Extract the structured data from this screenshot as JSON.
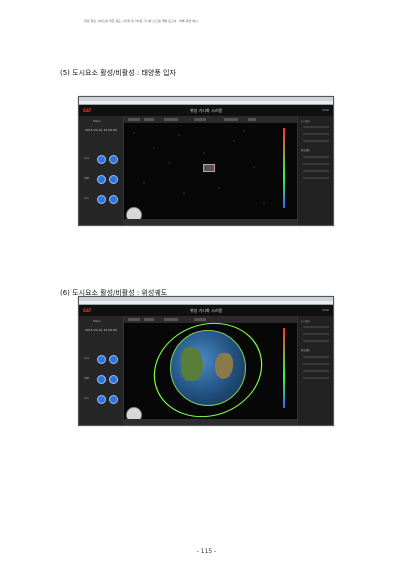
{
  "header": {
    "text": "위성 정보 서비스를 위한 궤도 시각화 및 3차원 가시화 시스템 개발 보고서 · 부록 화면 예시"
  },
  "sections": [
    {
      "title": "(5) 도시요소 활성/비활성 : 태양풍 입자"
    },
    {
      "title": "(6) 도시요소 활성/비활성 : 위성궤도"
    }
  ],
  "app": {
    "logo": "SAT",
    "title": "위성 가시화 시스템",
    "brand": "KASI",
    "left_label": "Menu",
    "utc_time": "2015-01-01 12:00:00",
    "circle_labels": [
      "AAA",
      "BBB",
      "CCC"
    ],
    "right_header_1": "도시요소",
    "right_header_2": "위성궤도"
  },
  "footer": {
    "page_number": "- 115 -"
  },
  "colors": {
    "primary_button": "#2f74d8",
    "orbit_line": "#7fff4a"
  }
}
